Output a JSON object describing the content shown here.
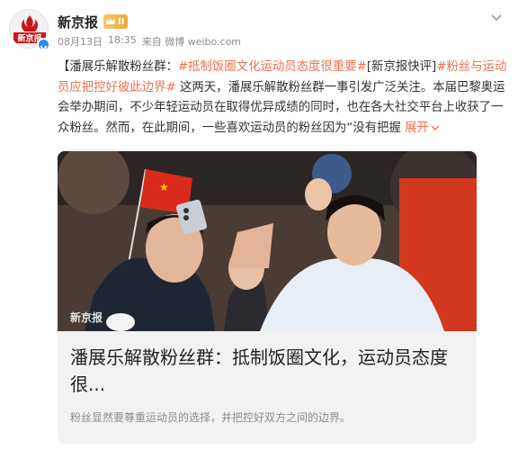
{
  "author": {
    "name": "新京报",
    "avatar_text": "新京报",
    "badge_level": "II",
    "badge_icon": "crown-icon",
    "verified_icon": "verified-v-icon"
  },
  "meta": {
    "date": "08月13日",
    "time": "18:35",
    "source": "来自 微博 weibo.com"
  },
  "post": {
    "prefix": "【潘展乐解散粉丝群：",
    "tag1": "#抵制饭圈文化运动员态度很重要#",
    "tag2": "[新京报快评]",
    "tag3": "#粉丝与运动员应把控好彼此边界#",
    "body": " 这两天，潘展乐解散粉丝群一事引发广泛关注。本届巴黎奥运会举办期间，不少年轻运动员在取得优异成绩的同时，也在各大社交平台上收获了一众粉丝。然而，在此期间，一些喜欢运动员的粉丝因为“没有把握 ",
    "expand": "展开",
    "expand_icon": "chevron-down-icon"
  },
  "card": {
    "watermark": "新京报",
    "title": "潘展乐解散粉丝群：抵制饭圈文化，运动员态度很...",
    "description": "粉丝显然要尊重运动员的选择，并把控好双方之间的边界。"
  },
  "colors": {
    "tag": "#eb7350",
    "brand_red": "#c8161d",
    "badge_gold": "#f0b453",
    "verified_blue": "#2d8cf0"
  }
}
